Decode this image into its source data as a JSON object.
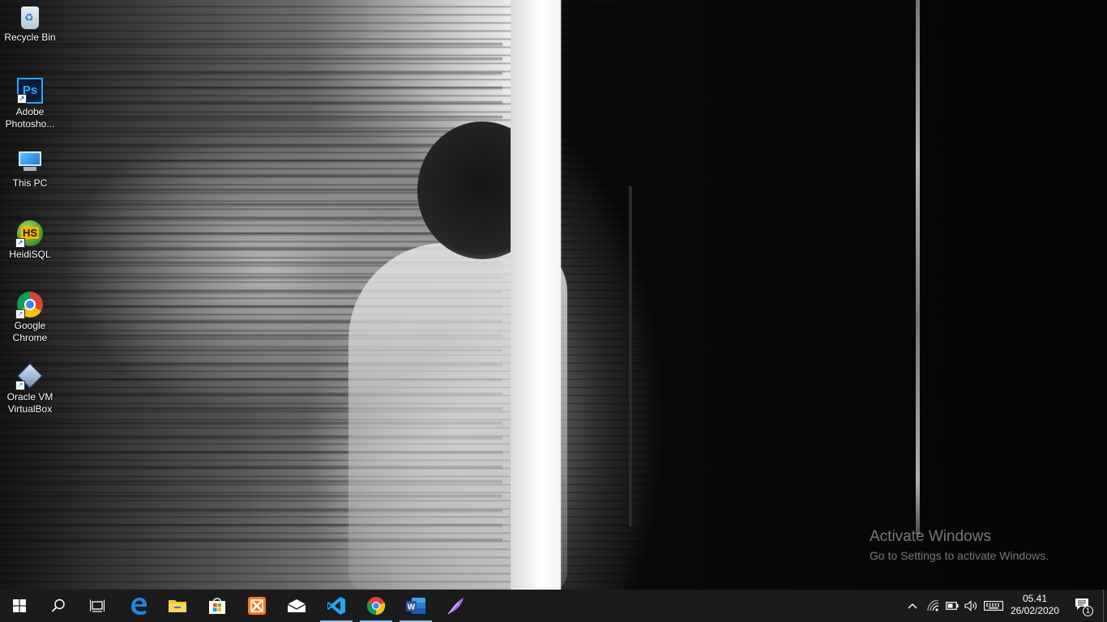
{
  "desktop": {
    "icons": [
      {
        "label": "Recycle Bin",
        "icon": "recycle-bin-icon"
      },
      {
        "label": "Adobe Photosho...",
        "icon": "photoshop-icon",
        "glyph": "Ps"
      },
      {
        "label": "This PC",
        "icon": "computer-icon"
      },
      {
        "label": "HeidiSQL",
        "icon": "heidisql-icon",
        "glyph": "HS"
      },
      {
        "label": "Google Chrome",
        "icon": "chrome-icon"
      },
      {
        "label": "Oracle VM VirtualBox",
        "icon": "virtualbox-icon"
      }
    ]
  },
  "watermark": {
    "title": "Activate Windows",
    "subtitle": "Go to Settings to activate Windows."
  },
  "taskbar": {
    "buttons": [
      {
        "name": "start",
        "icon": "windows-logo-icon"
      },
      {
        "name": "search",
        "icon": "search-icon"
      },
      {
        "name": "task-view",
        "icon": "task-view-icon"
      },
      {
        "name": "edge",
        "icon": "edge-icon"
      },
      {
        "name": "file-explorer",
        "icon": "folder-icon"
      },
      {
        "name": "store",
        "icon": "store-icon"
      },
      {
        "name": "xampp",
        "icon": "xampp-icon"
      },
      {
        "name": "mail",
        "icon": "mail-icon"
      },
      {
        "name": "vscode",
        "icon": "vscode-icon",
        "active": true
      },
      {
        "name": "chrome",
        "icon": "chrome-icon",
        "active": true
      },
      {
        "name": "word",
        "icon": "word-icon",
        "active": true
      },
      {
        "name": "feather-app",
        "icon": "feather-icon"
      }
    ],
    "tray": {
      "icons": [
        "chevron-up-icon",
        "wifi-icon",
        "battery-icon",
        "volume-icon",
        "keyboard-icon"
      ],
      "time": "05.41",
      "date": "26/02/2020",
      "notification_count": "1"
    }
  },
  "colors": {
    "taskbar_bg": "#1b1b1b",
    "active_indicator": "#76b9ed",
    "word_blue": "#2b579a",
    "vscode_blue": "#23a9f2",
    "edge_blue": "#1e88e5"
  }
}
